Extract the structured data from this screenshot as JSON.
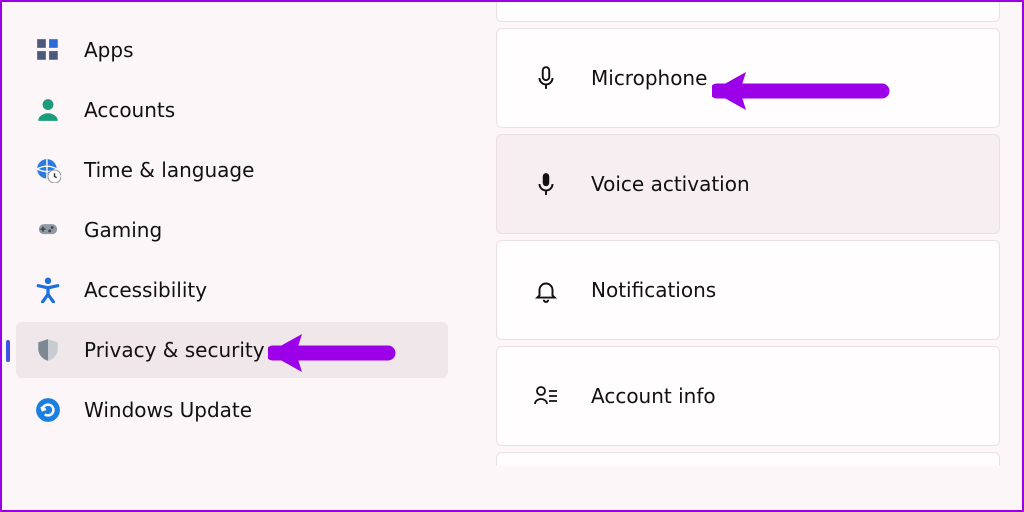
{
  "sidebar": {
    "items": [
      {
        "label": "Apps"
      },
      {
        "label": "Accounts"
      },
      {
        "label": "Time & language"
      },
      {
        "label": "Gaming"
      },
      {
        "label": "Accessibility"
      },
      {
        "label": "Privacy & security"
      },
      {
        "label": "Windows Update"
      }
    ]
  },
  "content": {
    "items": [
      {
        "label": "Microphone"
      },
      {
        "label": "Voice activation"
      },
      {
        "label": "Notifications"
      },
      {
        "label": "Account info"
      }
    ]
  },
  "colors": {
    "accent": "#3a54e4",
    "arrow": "#9b00e8"
  }
}
